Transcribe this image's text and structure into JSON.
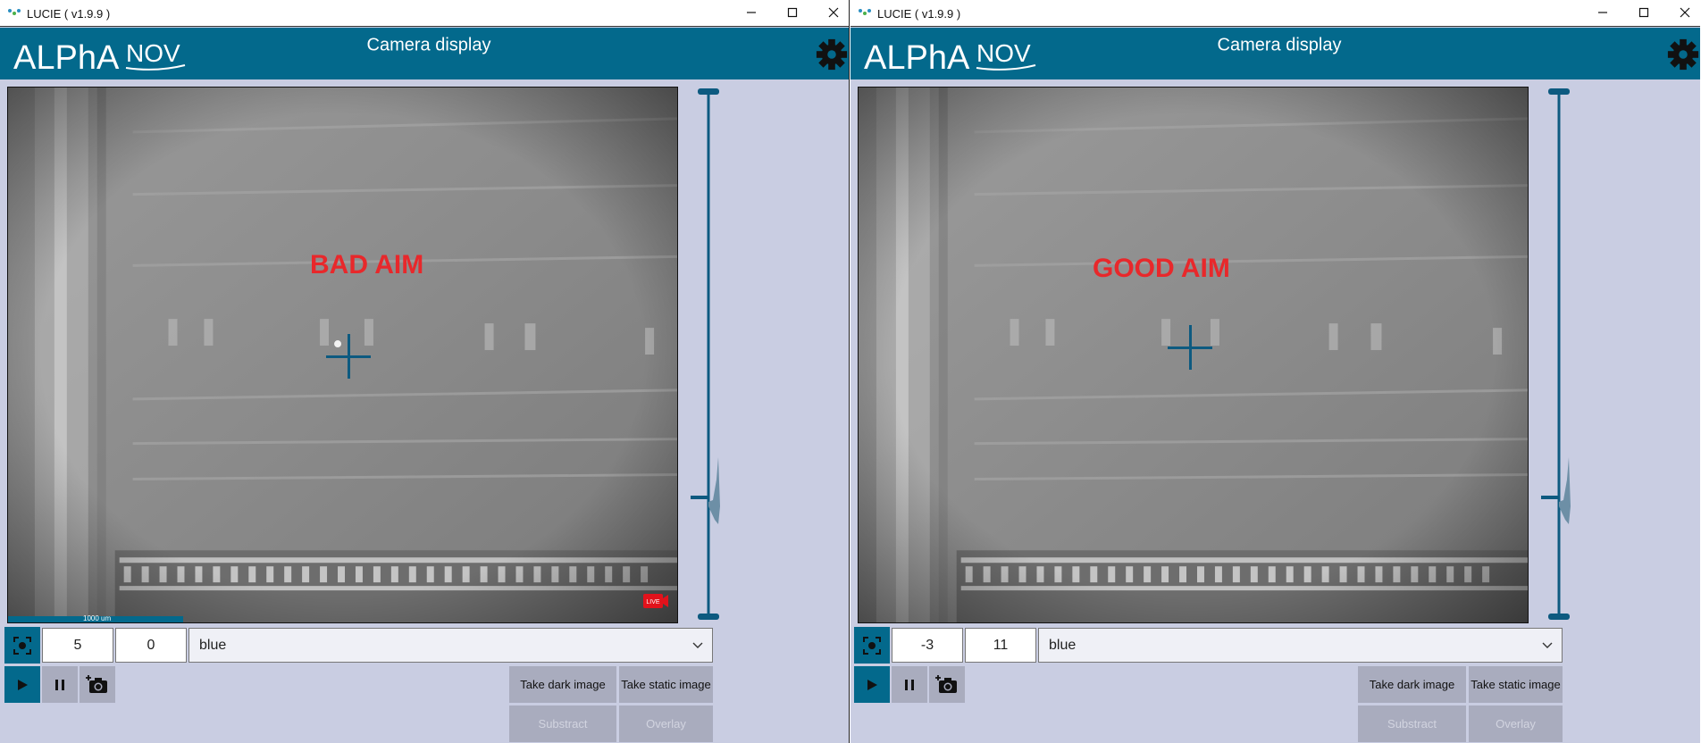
{
  "windows": [
    {
      "title": "LUCIE ( v1.9.9 )",
      "header_title": "Camera display",
      "logo": "ALPhA NOV",
      "aim_label": "BAD AIM",
      "scale_label": "1000 um",
      "live_badge": "LIVE",
      "offset_x": "5",
      "offset_y": "0",
      "colormap": "blue",
      "buttons": {
        "take_dark": "Take dark image",
        "take_static": "Take static image",
        "substract": "Substract",
        "overlay": "Overlay"
      }
    },
    {
      "title": "LUCIE ( v1.9.9 )",
      "header_title": "Camera display",
      "logo": "ALPhA NOV",
      "aim_label": "GOOD AIM",
      "offset_x": "-3",
      "offset_y": "11",
      "colormap": "blue",
      "buttons": {
        "take_dark": "Take dark image",
        "take_static": "Take static image",
        "substract": "Substract",
        "overlay": "Overlay"
      }
    }
  ],
  "colors": {
    "header": "#03698c",
    "panel": "#c9cde2",
    "aim_label": "#e8282b",
    "button_grey": "#a9acbe"
  },
  "icons": [
    "focus-icon",
    "play-icon",
    "pause-icon",
    "add-snapshot-icon",
    "gear-icon",
    "chevron-down-icon",
    "minimize-icon",
    "maximize-icon",
    "close-icon",
    "live-camera-icon"
  ]
}
